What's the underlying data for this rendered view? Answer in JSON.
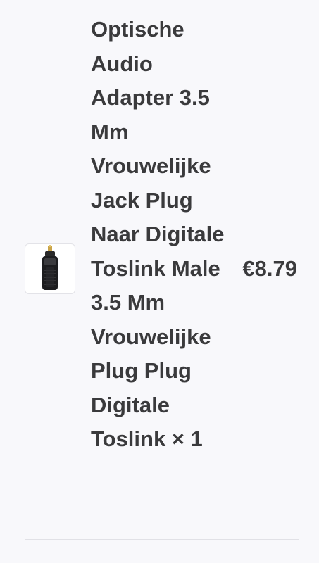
{
  "order_summary": {
    "items": [
      {
        "image_icon": "toslink-adapter-image",
        "name": "Optische Audio Adapter 3.5 Mm Vrouwelijke Jack Plug Naar Digitale Toslink Male 3.5 Mm Vrouwelijke Plug Plug Digitale Toslink",
        "quantity_text": "× 1",
        "price": "€8.79"
      }
    ]
  }
}
